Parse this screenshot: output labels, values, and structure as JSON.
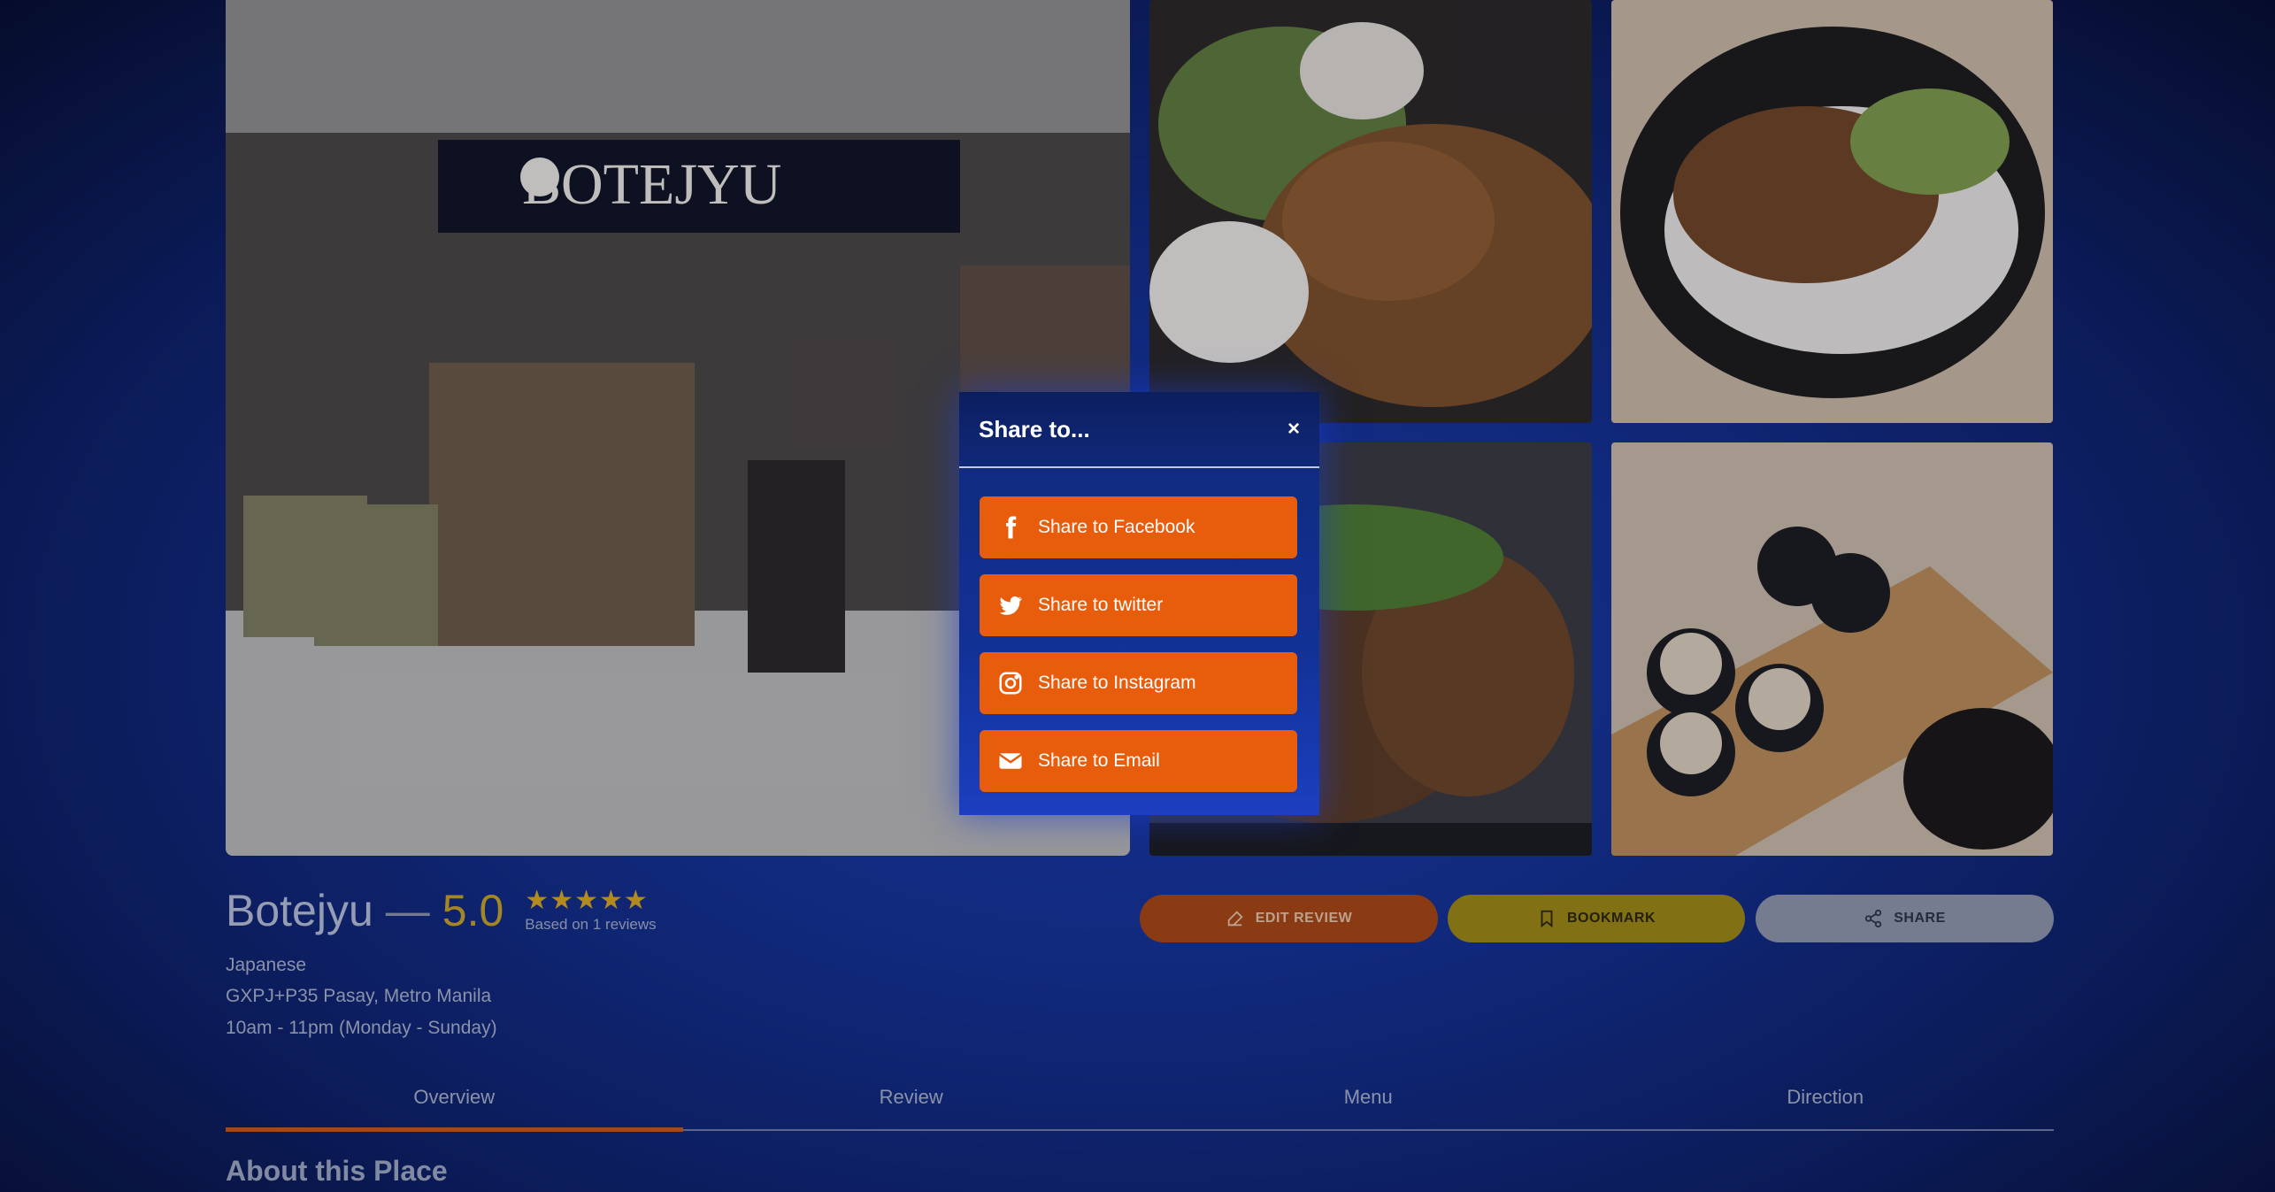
{
  "share_modal": {
    "title": "Share to...",
    "close": "×",
    "options": [
      {
        "label": "Share to Facebook",
        "icon": "facebook-icon"
      },
      {
        "label": "Share to twitter",
        "icon": "twitter-icon"
      },
      {
        "label": "Share to Instagram",
        "icon": "instagram-icon"
      },
      {
        "label": "Share to Email",
        "icon": "email-icon"
      }
    ]
  },
  "place": {
    "name": "Botejyu",
    "separator": "—",
    "rating": "5.0",
    "stars": "★★★★★",
    "rating_value": 5,
    "rating_max": 5,
    "based_on": "Based on 1 reviews",
    "cuisine": "Japanese",
    "address": "GXPJ+P35 Pasay, Metro Manila",
    "hours": "10am - 11pm (Monday - Sunday)"
  },
  "actions": {
    "edit_review": "EDIT REVIEW",
    "bookmark": "BOOKMARK",
    "share": "SHARE"
  },
  "tabs": [
    {
      "label": "Overview",
      "active": true
    },
    {
      "label": "Review",
      "active": false
    },
    {
      "label": "Menu",
      "active": false
    },
    {
      "label": "Direction",
      "active": false
    }
  ],
  "section_title": "About this Place",
  "storefront_sign": "BOTEJYU",
  "colors": {
    "accent_orange": "#e85d0c",
    "bookmark_yellow": "#9d8711",
    "star_gold": "#d9a520",
    "background_blue": "#14308f"
  }
}
